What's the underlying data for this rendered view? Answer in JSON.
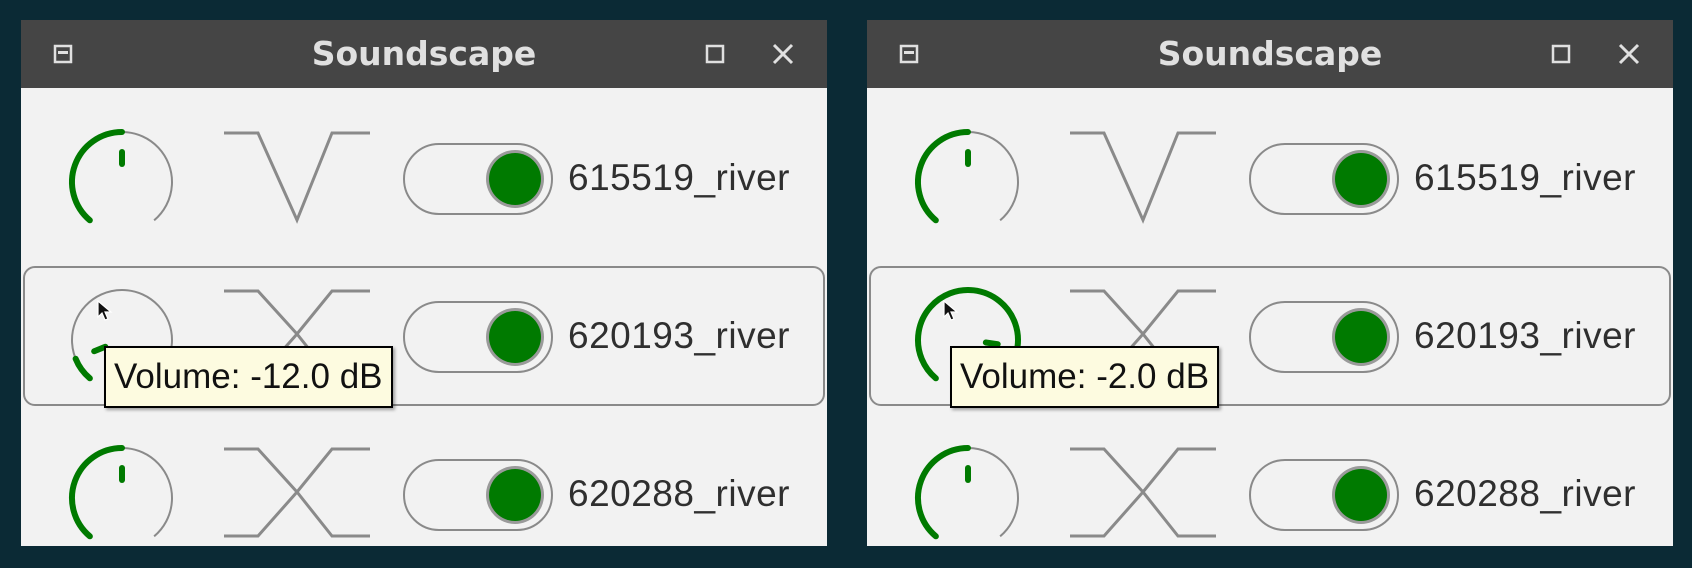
{
  "windows": [
    {
      "title": "Soundscape",
      "rows": [
        {
          "name": "615519_river",
          "volume_fraction": 0.5,
          "curve": "v",
          "enabled": true
        },
        {
          "name": "620193_river",
          "volume_fraction": 0.1,
          "curve": "x",
          "enabled": true
        },
        {
          "name": "620288_river",
          "volume_fraction": 0.5,
          "curve": "x",
          "enabled": true
        }
      ],
      "tooltip": "Volume: -12.0 dB"
    },
    {
      "title": "Soundscape",
      "rows": [
        {
          "name": "615519_river",
          "volume_fraction": 0.5,
          "curve": "v",
          "enabled": true
        },
        {
          "name": "620193_river",
          "volume_fraction": 0.85,
          "curve": "x",
          "enabled": true
        },
        {
          "name": "620288_river",
          "volume_fraction": 0.5,
          "curve": "x",
          "enabled": true
        }
      ],
      "tooltip": "Volume: -2.0 dB"
    }
  ],
  "colors": {
    "accent": "#007a00",
    "titlebar": "#454545",
    "background": "#0b2a35",
    "panel": "#f2f2f2",
    "outline": "#8a8a8a"
  },
  "icons": {
    "menu": "window-menu-icon",
    "maximize": "maximize-icon",
    "close": "close-icon"
  }
}
